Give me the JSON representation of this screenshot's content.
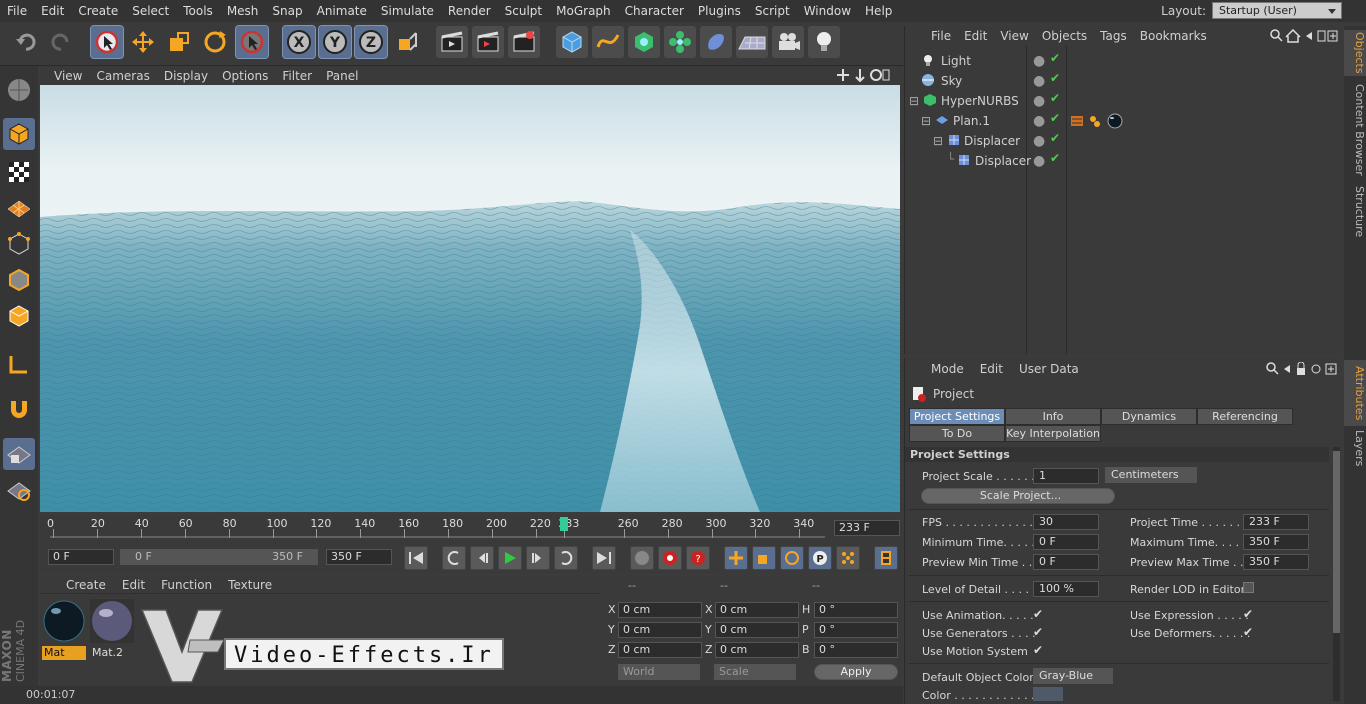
{
  "menubar": {
    "items": [
      "File",
      "Edit",
      "Create",
      "Select",
      "Tools",
      "Mesh",
      "Snap",
      "Animate",
      "Simulate",
      "Render",
      "Sculpt",
      "MoGraph",
      "Character",
      "Plugins",
      "Script",
      "Window",
      "Help"
    ],
    "layout_label": "Layout:",
    "layout_value": "Startup (User)"
  },
  "viewport": {
    "menu": [
      "View",
      "Cameras",
      "Display",
      "Options",
      "Filter",
      "Panel"
    ]
  },
  "timeline": {
    "ticks": [
      "0",
      "20",
      "40",
      "60",
      "80",
      "100",
      "120",
      "140",
      "160",
      "180",
      "200",
      "220",
      "233",
      "260",
      "280",
      "300",
      "320",
      "340"
    ],
    "current_frame": "233 F"
  },
  "transport": {
    "start_field": "0 F",
    "range_start": "0 F",
    "range_end": "350 F",
    "end_field": "350 F"
  },
  "materials": {
    "menu": [
      "Create",
      "Edit",
      "Function",
      "Texture"
    ],
    "items": [
      {
        "name": "Mat",
        "selected": true
      },
      {
        "name": "Mat.2",
        "selected": false
      }
    ],
    "brand_top": "MAXON",
    "brand_bottom": "CINEMA 4D",
    "watermark": "Video-Effects.Ir"
  },
  "coords": {
    "headers": [
      "--",
      "--",
      "--"
    ],
    "rows": [
      {
        "a": "X",
        "av": "0 cm",
        "b": "X",
        "bv": "0 cm",
        "c": "H",
        "cv": "0 °"
      },
      {
        "a": "Y",
        "av": "0 cm",
        "b": "Y",
        "bv": "0 cm",
        "c": "P",
        "cv": "0 °"
      },
      {
        "a": "Z",
        "av": "0 cm",
        "b": "Z",
        "bv": "0 cm",
        "c": "B",
        "cv": "0 °"
      }
    ],
    "world": "World",
    "scale": "Scale",
    "apply": "Apply"
  },
  "status": {
    "time": "00:01:07"
  },
  "objects": {
    "menu": [
      "File",
      "Edit",
      "View",
      "Objects",
      "Tags",
      "Bookmarks"
    ],
    "items": [
      {
        "name": "Light",
        "indent": 0
      },
      {
        "name": "Sky",
        "indent": 0
      },
      {
        "name": "HyperNURBS",
        "indent": 0
      },
      {
        "name": "Plan.1",
        "indent": 1
      },
      {
        "name": "Displacer",
        "indent": 2
      },
      {
        "name": "Displacer",
        "indent": 3
      }
    ]
  },
  "attributes": {
    "menu": [
      "Mode",
      "Edit",
      "User Data"
    ],
    "title": "Project",
    "tabs_row1": [
      "Project Settings",
      "Info",
      "Dynamics",
      "Referencing"
    ],
    "tabs_row2": [
      "To Do",
      "Key Interpolation"
    ],
    "section": "Project Settings",
    "project_scale_label": "Project Scale . . . . . .",
    "project_scale_value": "1",
    "project_scale_unit": "Centimeters",
    "scale_project_btn": "Scale Project...",
    "fps_label": "FPS . . . . . . . . . . . . . .",
    "fps_value": "30",
    "project_time_label": "Project Time . . . . . . . .",
    "project_time_value": "233 F",
    "min_time_label": "Minimum Time. . . . . .",
    "min_time_value": "0 F",
    "max_time_label": "Maximum Time. . . . . . .",
    "max_time_value": "350 F",
    "prev_min_label": "Preview Min Time . .",
    "prev_min_value": "0 F",
    "prev_max_label": "Preview Max Time . . .",
    "prev_max_value": "350 F",
    "lod_label": "Level of Detail . . . . .",
    "lod_value": "100 %",
    "render_lod_label": "Render LOD in Editor",
    "use_animation_label": "Use Animation. . . . .",
    "use_expression_label": "Use Expression . . . . .",
    "use_generators_label": "Use Generators . . . .",
    "use_deformers_label": "Use Deformers. . . . . .",
    "use_motion_label": "Use Motion System",
    "default_color_label": "Default Object Color",
    "default_color_value": "Gray-Blue",
    "color_label": "Color . . . . . . . . . . . ."
  },
  "right_tabs": {
    "top": [
      "Objects",
      "Content Browser",
      "Structure"
    ],
    "bottom": [
      "Attributes",
      "Layers"
    ]
  }
}
